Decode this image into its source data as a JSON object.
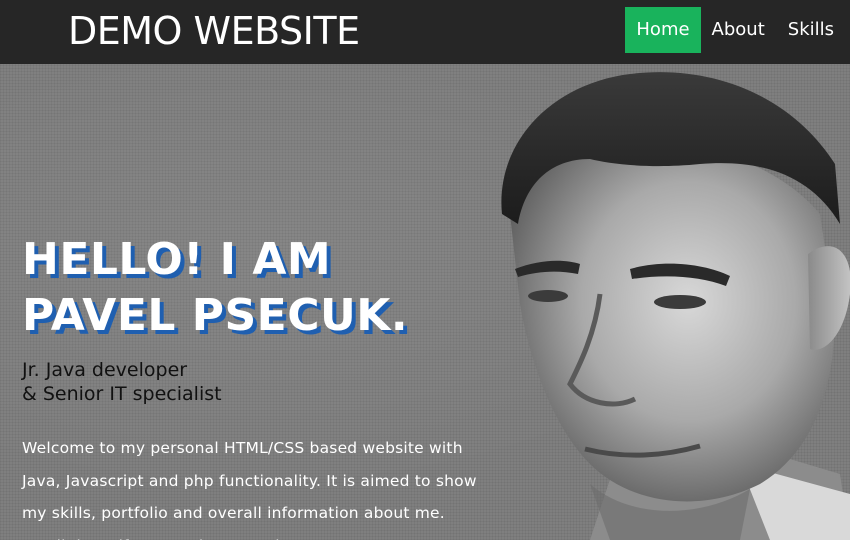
{
  "header": {
    "brand": "DEMO WEBSITE",
    "nav": [
      {
        "label": "Home",
        "active": true
      },
      {
        "label": "About",
        "active": false
      },
      {
        "label": "Skills",
        "active": false
      }
    ]
  },
  "hero": {
    "headline_line1": "HELLO! I AM",
    "headline_line2": "PAVEL PSECUK.",
    "subtitle_line1": "Jr. Java developer",
    "subtitle_line2": "& Senior IT specialist",
    "intro_lines": [
      "Welcome to my personal HTML/CSS based website with",
      "Java, Javascript and php functionality. It is aimed to show",
      "my skills, portfolio and overall information about me.",
      "Scroll down if you are interested!"
    ],
    "portrait_icon": "portrait-photo"
  },
  "colors": {
    "topbar": "#262626",
    "nav_active": "#19b35c",
    "headline_shadow": "#1f5fb0",
    "hero_background": "#7f7f7f"
  }
}
